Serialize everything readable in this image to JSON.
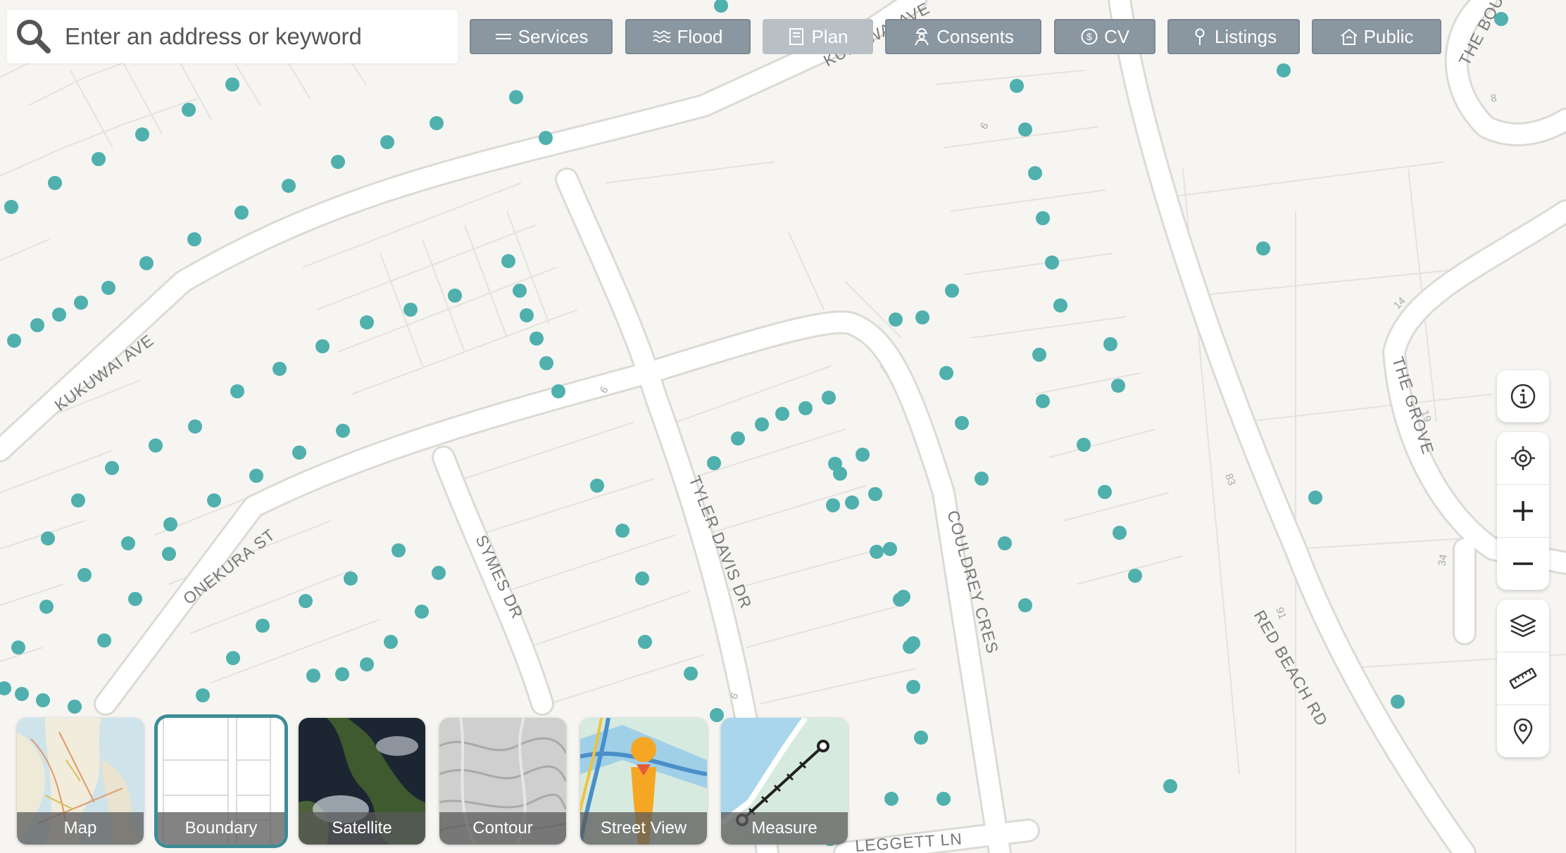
{
  "search": {
    "placeholder": "Enter an address or keyword",
    "icon": "search-icon"
  },
  "toolbar": [
    {
      "label": "Services",
      "icon": "menu-lines-icon",
      "enabled": true
    },
    {
      "label": "Flood",
      "icon": "waves-icon",
      "enabled": true
    },
    {
      "label": "Plan",
      "icon": "document-icon",
      "enabled": false
    },
    {
      "label": "Consents",
      "icon": "construction-worker-icon",
      "enabled": true
    },
    {
      "label": "CV",
      "icon": "dollar-circle-icon",
      "enabled": true
    },
    {
      "label": "Listings",
      "icon": "map-pin-icon",
      "enabled": true
    },
    {
      "label": "Public",
      "icon": "public-building-icon",
      "enabled": true
    }
  ],
  "map": {
    "roads": {
      "kukuwai_ave": "KUKUWAI AVE",
      "kukuwai_ave_top": "KUKUWAI AVE",
      "onekura_st": "ONEKURA ST",
      "symes_dr": "SYMES DR",
      "tyler_davis_dr": "TYLER DAVIS DR",
      "couldrey_cres": "COULDREY CRES",
      "red_beach_rd": "RED BEACH RD",
      "the_grove": "THE GROVE",
      "the_boulevard": "THE BOULEVARD",
      "leggett_ln": "LEGGETT LN"
    },
    "house_numbers": [
      "6",
      "6",
      "6",
      "83",
      "91",
      "14",
      "19",
      "34",
      "8"
    ],
    "dot_color": "#4fb0ad"
  },
  "controls": {
    "info": "info-icon",
    "locate": "locate-icon",
    "zoom_in": "plus-icon",
    "zoom_out": "minus-icon",
    "layers": "layers-icon",
    "measure": "ruler-icon",
    "pin": "map-pin-icon"
  },
  "base_layers": [
    {
      "label": "Map",
      "selected": false
    },
    {
      "label": "Boundary",
      "selected": true
    },
    {
      "label": "Satellite",
      "selected": false
    },
    {
      "label": "Contour",
      "selected": false
    },
    {
      "label": "Street View",
      "selected": false
    },
    {
      "label": "Measure",
      "selected": false
    }
  ]
}
